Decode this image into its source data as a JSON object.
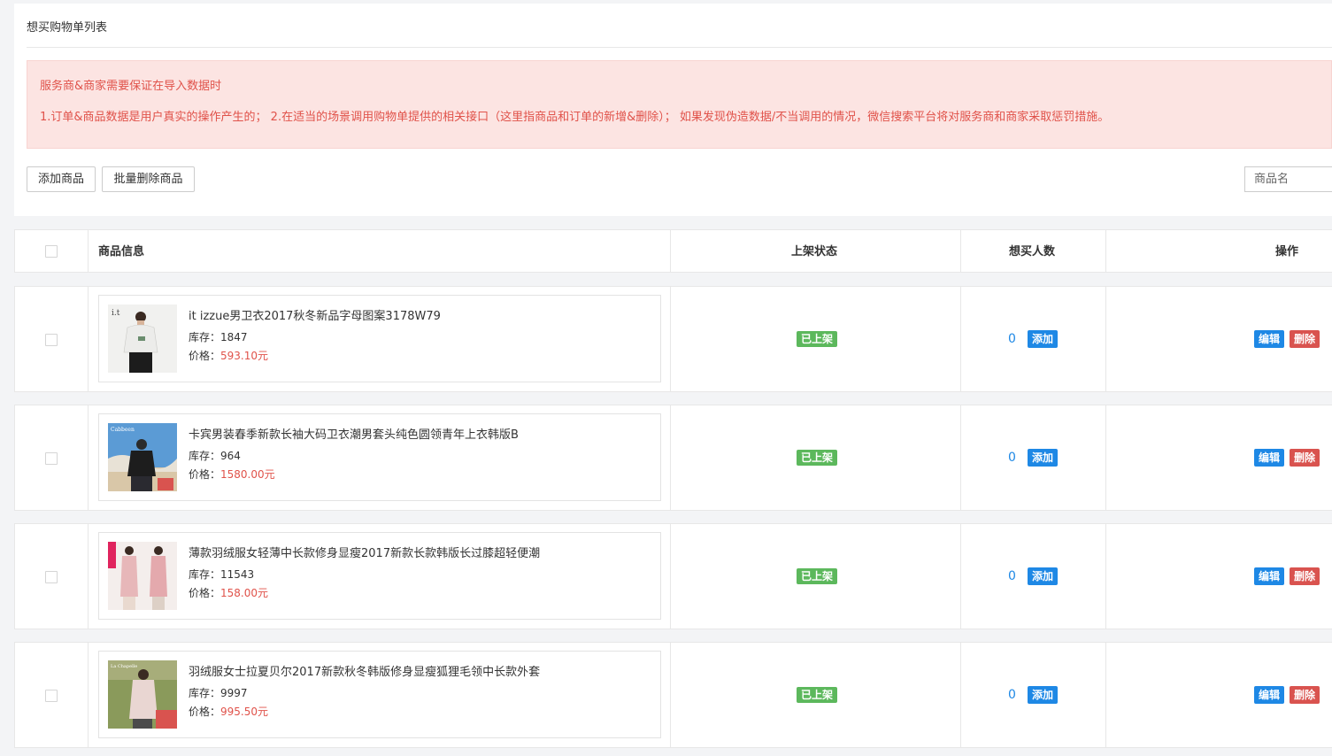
{
  "page": {
    "title": "想买购物单列表"
  },
  "alert": {
    "title": "服务商&商家需要保证在导入数据时",
    "text": "1.订单&商品数据是用户真实的操作产生的； 2.在适当的场景调用购物单提供的相关接口（这里指商品和订单的新增&删除）； 如果发现伪造数据/不当调用的情况，微信搜索平台将对服务商和商家采取惩罚措施。"
  },
  "toolbar": {
    "add_label": "添加商品",
    "batch_delete_label": "批量删除商品",
    "search_placeholder": "商品名"
  },
  "table": {
    "headers": {
      "info": "商品信息",
      "status": "上架状态",
      "want": "想买人数",
      "ops": "操作"
    }
  },
  "products": [
    {
      "name": "it izzue男卫衣2017秋冬新品字母图案3178W79",
      "stock_label": "库存：",
      "stock": "1847",
      "price_label": "价格：",
      "price": "593.10元",
      "status": "已上架",
      "want": "0",
      "want_add": "添加",
      "edit": "编辑",
      "delete": "删除"
    },
    {
      "name": "卡宾男装春季新款长袖大码卫衣潮男套头纯色圆领青年上衣韩版B",
      "stock_label": "库存：",
      "stock": "964",
      "price_label": "价格：",
      "price": "1580.00元",
      "status": "已上架",
      "want": "0",
      "want_add": "添加",
      "edit": "编辑",
      "delete": "删除"
    },
    {
      "name": "薄款羽绒服女轻薄中长款修身显瘦2017新款长款韩版长过膝超轻便潮",
      "stock_label": "库存：",
      "stock": "11543",
      "price_label": "价格：",
      "price": "158.00元",
      "status": "已上架",
      "want": "0",
      "want_add": "添加",
      "edit": "编辑",
      "delete": "删除"
    },
    {
      "name": "羽绒服女士拉夏贝尔2017新款秋冬韩版修身显瘦狐狸毛领中长款外套",
      "stock_label": "库存：",
      "stock": "9997",
      "price_label": "价格：",
      "price": "995.50元",
      "status": "已上架",
      "want": "0",
      "want_add": "添加",
      "edit": "编辑",
      "delete": "删除"
    }
  ],
  "colors": {
    "alert_text": "#e0524a",
    "alert_bg": "#fce4e2",
    "status_green": "#5cb85c",
    "primary_blue": "#1e88e5",
    "danger_red": "#d9534f"
  }
}
